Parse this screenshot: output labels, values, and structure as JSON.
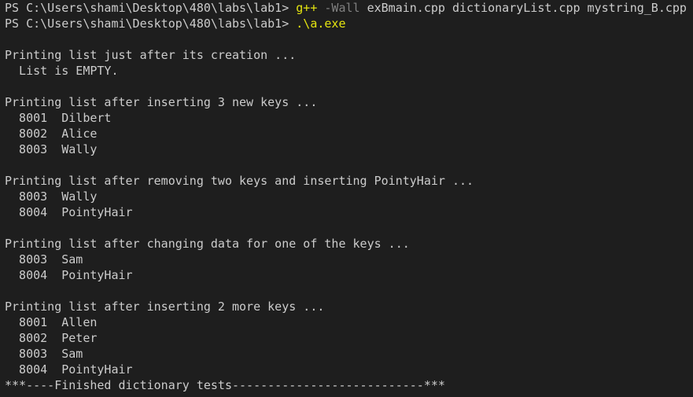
{
  "prompt_1": {
    "prefix": "PS C:\\Users\\shami\\Desktop\\480\\labs\\lab1> ",
    "command": "g++",
    "flag": " -Wall",
    "args": " exBmain.cpp dictionaryList.cpp mystring_B.cpp"
  },
  "prompt_2": {
    "prefix": "PS C:\\Users\\shami\\Desktop\\480\\labs\\lab1> ",
    "command": ".\\a.exe"
  },
  "output": [
    "",
    "Printing list just after its creation ...",
    "  List is EMPTY.",
    "",
    "Printing list after inserting 3 new keys ...",
    "  8001  Dilbert",
    "  8002  Alice",
    "  8003  Wally",
    "",
    "Printing list after removing two keys and inserting PointyHair ...",
    "  8003  Wally",
    "  8004  PointyHair",
    "",
    "Printing list after changing data for one of the keys ...",
    "  8003  Sam",
    "  8004  PointyHair",
    "",
    "Printing list after inserting 2 more keys ...",
    "  8001  Allen",
    "  8002  Peter",
    "  8003  Sam",
    "  8004  PointyHair",
    "***----Finished dictionary tests---------------------------***"
  ],
  "colors": {
    "background": "#1e1e1e",
    "text": "#cccccc",
    "command": "#e5e510",
    "flag": "#808080"
  }
}
